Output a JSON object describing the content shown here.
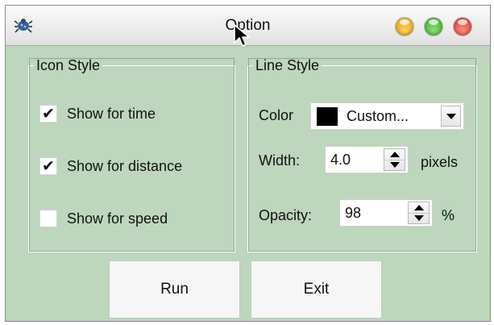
{
  "window": {
    "title": "Option"
  },
  "titlebar": {
    "app_icon": "bug-icon",
    "controls": [
      "minimize-button",
      "maximize-button",
      "close-button"
    ],
    "colors": {
      "minimize": "#f4b82e",
      "maximize": "#4fc03a",
      "close": "#e8463a"
    }
  },
  "icon_style": {
    "legend": "Icon Style",
    "options": [
      {
        "label": "Show for time",
        "checked": true
      },
      {
        "label": "Show for distance",
        "checked": true
      },
      {
        "label": "Show for speed",
        "checked": false
      }
    ]
  },
  "line_style": {
    "legend": "Line Style",
    "color_label": "Color",
    "color_value": "Custom...",
    "color_swatch": "#000000",
    "width_label": "Width:",
    "width_value": "4.0",
    "width_unit": "pixels",
    "opacity_label": "Opacity:",
    "opacity_value": "98",
    "opacity_unit": "%"
  },
  "buttons": {
    "run": "Run",
    "exit": "Exit"
  },
  "theme": {
    "background": "#bcd7bc"
  }
}
